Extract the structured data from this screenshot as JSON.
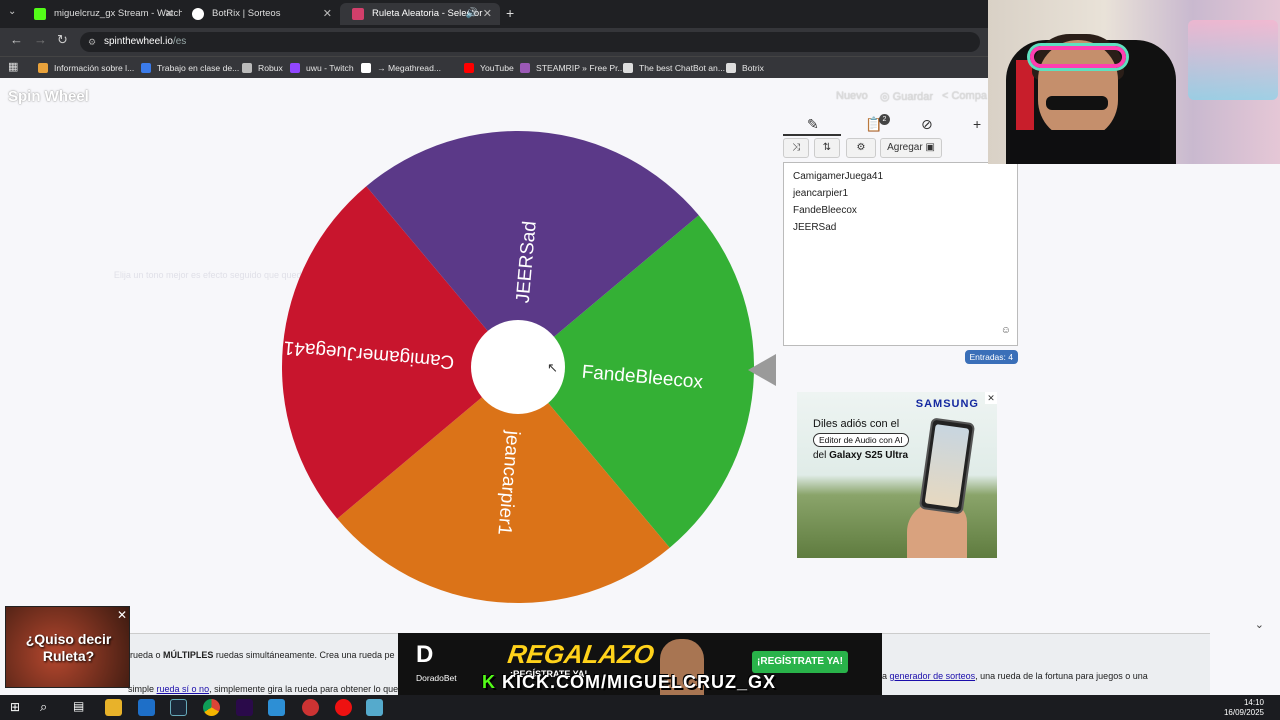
{
  "browser": {
    "tabs": [
      {
        "title": "miguelcruz_gx Stream - Watch",
        "color": "#53fc18"
      },
      {
        "title": "BotRix | Sorteos",
        "color": "#ffffff"
      },
      {
        "title": "Ruleta Aleatoria - Selector",
        "color": "#d23f6b"
      }
    ],
    "url_domain": "spinthewheel.io",
    "url_path": "/es",
    "bookmarks": [
      {
        "label": "Información sobre l...",
        "color": "#e9a23b"
      },
      {
        "label": "Trabajo en clase de...",
        "color": "#3b7be9"
      },
      {
        "label": "Robux",
        "color": "#bbbbbb"
      },
      {
        "label": "uwu - Twitch",
        "color": "#9146ff"
      },
      {
        "label": "→ Megathread...",
        "color": "#ffffff"
      },
      {
        "label": "YouTube",
        "color": "#ff0000"
      },
      {
        "label": "STEAMRIP » Free Pr...",
        "color": "#9b59b6"
      },
      {
        "label": "The best ChatBot an...",
        "color": "#dddddd"
      },
      {
        "label": "Botrix",
        "color": "#dddddd"
      }
    ]
  },
  "app": {
    "logo": "Spin Wheel",
    "actions": {
      "new": "Nuevo",
      "save": "Guardar",
      "share": "Compa"
    },
    "hint": "Elija un tono mejor es efecto seguido que queda esta"
  },
  "wheel": {
    "segments": [
      {
        "label": "FandeBleecox",
        "color": "#34b035"
      },
      {
        "label": "jeancarpier1",
        "color": "#db7318"
      },
      {
        "label": "CamigamerJuega41",
        "color": "#c8152d"
      },
      {
        "label": "JEERSad",
        "color": "#5b3988"
      }
    ]
  },
  "panel": {
    "add_label": "Agregar",
    "badge": "2",
    "entries": [
      "CamigamerJuega41",
      "jeancarpier1",
      "FandeBleecox",
      "JEERSad"
    ],
    "count_label": "Entradas: 4"
  },
  "ad": {
    "brand": "SAMSUNG",
    "line1": "Diles adiós con el",
    "line2": "Editor de Audio con AI",
    "line3_prefix": "del",
    "line3_product": "Galaxy S25 Ultra"
  },
  "textband": {
    "line1_start": "rueda o",
    "line1_bold": "MÚLTIPLES",
    "line1_rest": "ruedas simultáneamente. Crea una rueda pe",
    "line2_start": "a",
    "line2_link": "generador de sorteos",
    "line2_rest": ", una rueda de la fortuna para juegos o una",
    "line3_prefix": "simple",
    "line3_link": "rueda sí o no",
    "line3_rest": ", simplemente gira la rueda para obtener lo que nec"
  },
  "promo": {
    "text": "¿Quiso decir Ruleta?"
  },
  "banner": {
    "brand": "DoradoBet",
    "headline": "REGALAZO",
    "sub": "¡REGÍSTRATE YA!",
    "cta": "¡REGÍSTRATE YA!",
    "kick_prefix": "K",
    "kick_text": "KICK.COM/MIGUELCRUZ_GX"
  },
  "taskbar": {
    "time": "14:10",
    "date": "16/09/2025"
  }
}
